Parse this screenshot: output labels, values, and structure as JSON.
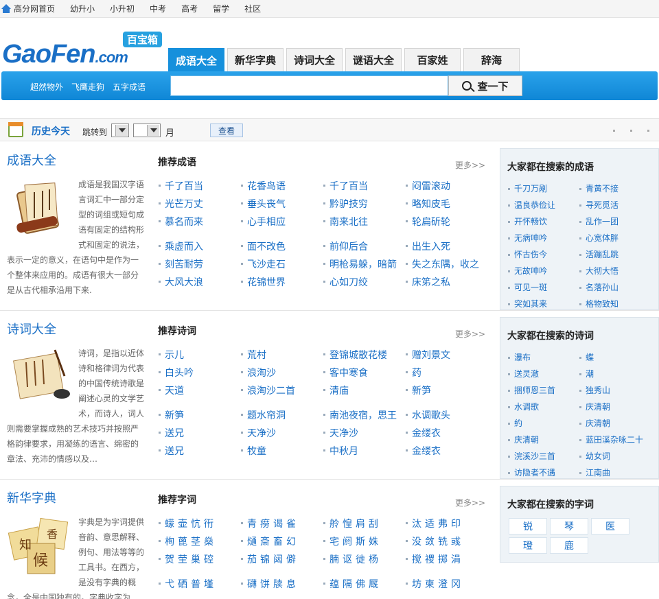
{
  "topnav": [
    "高分网首页",
    "幼升小",
    "小升初",
    "中考",
    "高考",
    "留学",
    "社区"
  ],
  "logo": {
    "text": "GaoFen",
    "suffix": ".com",
    "badge": "百宝箱"
  },
  "tabs": [
    "成语大全",
    "新华字典",
    "诗词大全",
    "谜语大全",
    "百家姓",
    "辞海"
  ],
  "search": {
    "hot": [
      "超然物外",
      "飞鹰走狗",
      "五字成语"
    ],
    "button": "查一下",
    "value": ""
  },
  "history": {
    "title": "历史今天",
    "jump": "跳转到",
    "month": "月",
    "button": "查看"
  },
  "chengyu": {
    "title": "成语大全",
    "desc": "成语是我国汉字语言词汇中一部分定型的词组或短句成语有固定的结构形式和固定的说法，表示一定的意义，在语句中是作为一个整体来应用的。成语有很大一部分是从古代相承沿用下来.",
    "rec": "推荐成语",
    "more": "更多>>",
    "rows": [
      [
        "千了百当",
        "花香鸟语",
        "千了百当",
        "闷雷滚动"
      ],
      [
        "光芒万丈",
        "垂头丧气",
        "黔驴技穷",
        "略知皮毛"
      ],
      [
        "慕名而来",
        "心手相应",
        "南来北往",
        "轮扁斫轮"
      ],
      [
        "乘虚而入",
        "面不改色",
        "前仰后合",
        "出生入死"
      ],
      [
        "刻苦耐劳",
        "飞沙走石",
        "明枪易躲，暗箭",
        "失之东隅，收之"
      ],
      [
        "大风大浪",
        "花锦世界",
        "心如刀绞",
        "床笫之私"
      ]
    ],
    "side_title": "大家都在搜索的成语",
    "side": [
      "千刀万剐",
      "青黄不接",
      "温良恭俭让",
      "寻死觅活",
      "开怀畅饮",
      "乱作一团",
      "无病呻吟",
      "心宽体胖",
      "怀古伤今",
      "活蹦乱跳",
      "无故呻吟",
      "大彻大悟",
      "可见一斑",
      "名落孙山",
      "突如其来",
      "格物致知"
    ]
  },
  "shici": {
    "title": "诗词大全",
    "desc": "诗词，是指以近体诗和格律词为代表的中国传统诗歌是阐述心灵的文学艺术，而诗人，词人则需要掌握成熟的艺术技巧并按照严格韵律要求，用凝练的语言、绵密的章法、充沛的情感以及…",
    "rec": "推荐诗词",
    "more": "更多>>",
    "rows": [
      [
        "示儿",
        "荒村",
        "登锦城散花楼",
        "赠刘景文"
      ],
      [
        "白头吟",
        "浪淘沙",
        "客中寒食",
        "药"
      ],
      [
        "天道",
        "浪淘沙二首",
        "清庙",
        "新笋"
      ],
      [
        "新笋",
        "题水帘洞",
        "南池夜宿，思王",
        "水调歌头"
      ],
      [
        "送兄",
        "天净沙",
        "天净沙",
        "金缕衣"
      ],
      [
        "送兄",
        "牧童",
        "中秋月",
        "金缕衣"
      ]
    ],
    "side_title": "大家都在搜索的诗词",
    "side": [
      "瀑布",
      "蝶",
      "送灵澈",
      "潮",
      "捆师恩三首",
      "独秀山",
      "水调歌",
      "庆清朝",
      "約",
      "庆清朝",
      "庆清朝",
      "蓝田溪杂咏二十",
      "浣溪沙三首",
      "幼女词",
      "访隐者不遇",
      "江南曲"
    ]
  },
  "zidian": {
    "title": "新华字典",
    "desc": "字典是为字词提供音韵、意思解释、例句、用法等等的工具书。在西方，是没有字典的概念，全是中国独有的。字典收字为",
    "rec": "推荐字词",
    "more": "更多>>",
    "rows": [
      [
        "蠓壶忼衎",
        "青痨谒雀",
        "舲惶肩刮",
        "汰适弗印"
      ],
      [
        "栒蓖茎燊",
        "熥斎畜幻",
        "宅阏斯姝",
        "没敛铣彧"
      ],
      [
        "贺茔巢硿",
        "茄锦闼僻",
        "腩讴徙杨",
        "搅禝掷涓"
      ],
      [
        "弋硒普墐",
        "礴饼牍息",
        "蕴隔佛厩",
        "坊柬澄冈"
      ]
    ],
    "side_title": "大家都在搜索的字词",
    "side": [
      "锐",
      "琴",
      "医",
      "璒",
      "鹿"
    ]
  }
}
